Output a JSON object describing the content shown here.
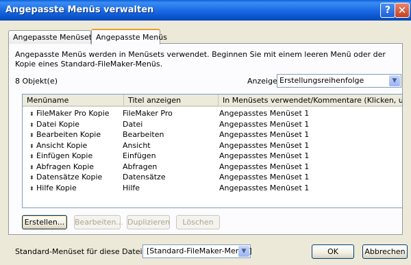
{
  "window": {
    "title": "Angepasste Menüs verwalten",
    "help_label": "?",
    "close_label": "✕"
  },
  "tabs": [
    {
      "label": "Angepasste Menüsets"
    },
    {
      "label": "Angepasste Menüs"
    }
  ],
  "description": "Angepasste Menüs werden in Menüsets verwendet. Beginnen Sie mit einem leeren Menü oder der Kopie eines Standard-FileMaker-Menüs.",
  "object_count": "8 Objekt(e)",
  "display": {
    "label": "Anzeige:",
    "value": "Erstellungsreihenfolge",
    "arrow": "▼"
  },
  "table": {
    "columns": [
      "Menüname",
      "Titel anzeigen",
      "In Menüsets verwendet/Kommentare  (Klicken, um u..."
    ],
    "rows": [
      {
        "name": "FileMaker Pro Kopie",
        "title": "FileMaker Pro",
        "used": "Angepasstes Menüset 1"
      },
      {
        "name": "Datei Kopie",
        "title": "Datei",
        "used": "Angepasstes Menüset 1"
      },
      {
        "name": "Bearbeiten Kopie",
        "title": "Bearbeiten",
        "used": "Angepasstes Menüset 1"
      },
      {
        "name": "Ansicht Kopie",
        "title": "Ansicht",
        "used": "Angepasstes Menüset 1"
      },
      {
        "name": "Einfügen Kopie",
        "title": "Einfügen",
        "used": "Angepasstes Menüset 1"
      },
      {
        "name": "Abfragen Kopie",
        "title": "Abfragen",
        "used": "Angepasstes Menüset 1"
      },
      {
        "name": "Datensätze Kopie",
        "title": "Datensätze",
        "used": "Angepasstes Menüset 1"
      },
      {
        "name": "Hilfe Kopie",
        "title": "Hilfe",
        "used": "Angepasstes Menüset 1"
      }
    ]
  },
  "actions": {
    "create": "Erstellen...",
    "edit": "Bearbeiten...",
    "duplicate": "Duplizieren",
    "delete": "Löschen"
  },
  "footer": {
    "default_label": "Standard-Menüset für diese Datei:",
    "default_value": "[Standard-FileMaker-Menüs]",
    "ok": "OK",
    "cancel": "Abbrechen"
  }
}
